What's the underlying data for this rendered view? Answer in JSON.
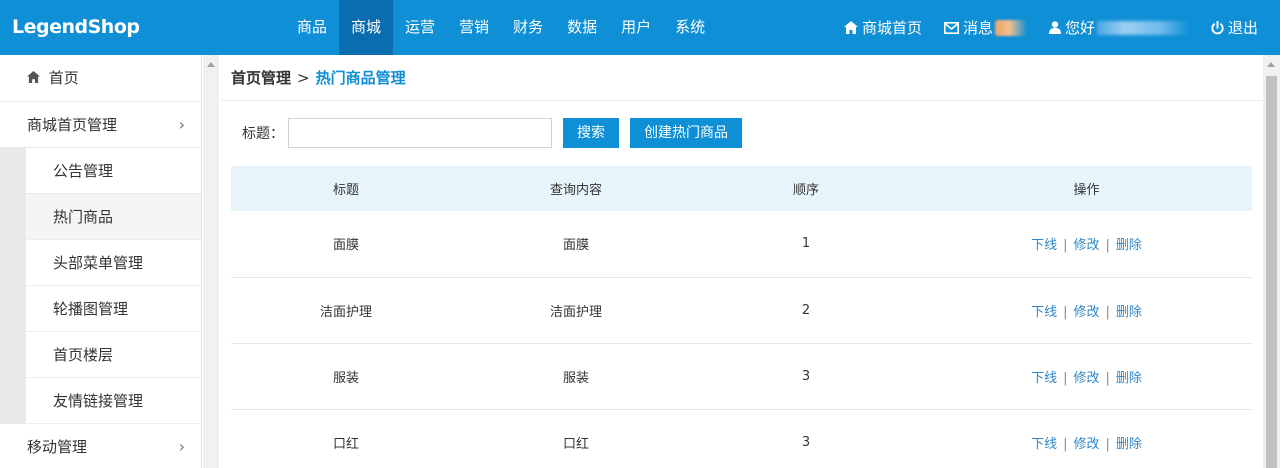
{
  "app": {
    "logo": "LegendShop"
  },
  "topnav": {
    "items": [
      "商品",
      "商城",
      "运营",
      "营销",
      "财务",
      "数据",
      "用户",
      "系统"
    ],
    "active_index": 1
  },
  "top_right": {
    "mall_home": "商城首页",
    "messages": "消息",
    "greeting": "您好",
    "logout": "退出"
  },
  "sidebar": {
    "home": "首页",
    "group_mall_home": "商城首页管理",
    "sub_items": [
      "公告管理",
      "热门商品",
      "头部菜单管理",
      "轮播图管理",
      "首页楼层",
      "友情链接管理"
    ],
    "active_sub_index": 1,
    "group_mobile": "移动管理"
  },
  "breadcrumb": {
    "parent": "首页管理",
    "separator": ">",
    "current": "热门商品管理"
  },
  "search": {
    "label": "标题：",
    "value": "",
    "placeholder": "",
    "search_button": "搜索",
    "create_button": "创建热门商品"
  },
  "table": {
    "headers": [
      "标题",
      "查询内容",
      "顺序",
      "操作"
    ],
    "rows": [
      {
        "title": "面膜",
        "query": "面膜",
        "order": "1"
      },
      {
        "title": "洁面护理",
        "query": "洁面护理",
        "order": "2"
      },
      {
        "title": "服装",
        "query": "服装",
        "order": "3"
      },
      {
        "title": "口红",
        "query": "口红",
        "order": "3"
      }
    ],
    "actions": {
      "offline": "下线",
      "edit": "修改",
      "delete": "删除",
      "separator": "|"
    }
  },
  "colors": {
    "brand": "#0f8fd6",
    "nav_active": "#0a6db0",
    "link": "#2e87c9",
    "table_header_bg": "#e8f4fb"
  }
}
